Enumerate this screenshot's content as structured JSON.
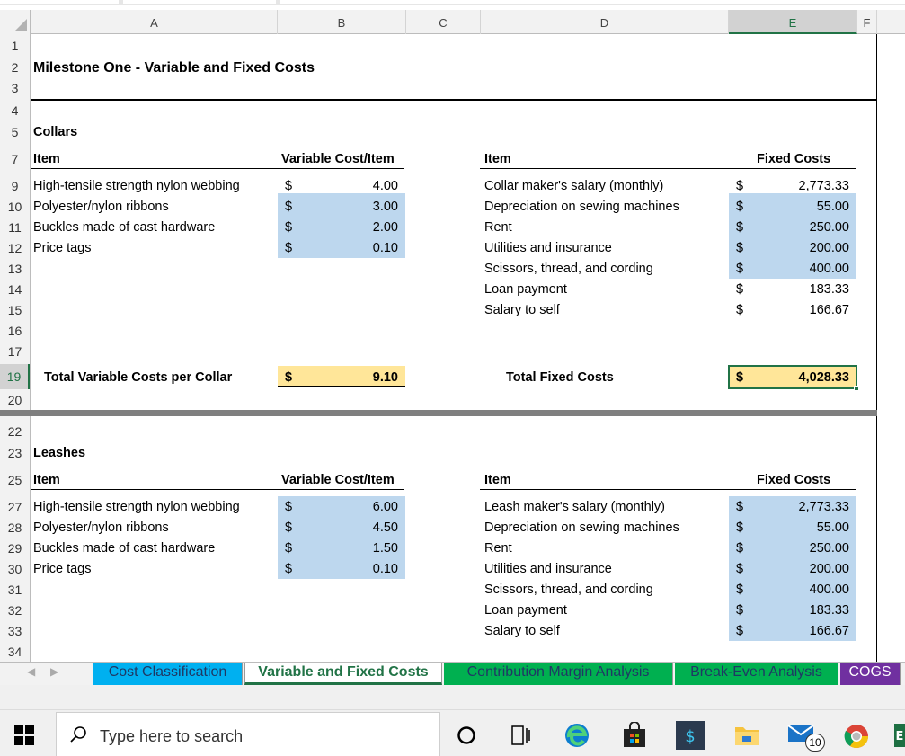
{
  "columns": [
    "A",
    "B",
    "C",
    "D",
    "E",
    "F"
  ],
  "rows": [
    "1",
    "2",
    "3",
    "4",
    "5",
    "7",
    "9",
    "10",
    "11",
    "12",
    "13",
    "14",
    "15",
    "16",
    "17",
    "19",
    "20",
    "22",
    "23",
    "25",
    "27",
    "28",
    "29",
    "30",
    "31",
    "32",
    "33",
    "34"
  ],
  "title": "Milestone One - Variable and Fixed Costs",
  "collars": {
    "heading": "Collars",
    "var_header": {
      "item": "Item",
      "cost": "Variable Cost/Item"
    },
    "fixed_header": {
      "item": "Item",
      "cost": "Fixed Costs"
    },
    "var_items": [
      {
        "name": "High-tensile strength nylon webbing",
        "cur": "$",
        "value": "4.00"
      },
      {
        "name": "Polyester/nylon ribbons",
        "cur": "$",
        "value": "3.00"
      },
      {
        "name": "Buckles made of cast hardware",
        "cur": "$",
        "value": "2.00"
      },
      {
        "name": "Price tags",
        "cur": "$",
        "value": "0.10"
      }
    ],
    "fixed_items": [
      {
        "name": "Collar maker's salary (monthly)",
        "cur": "$",
        "value": "2,773.33"
      },
      {
        "name": "Depreciation on sewing machines",
        "cur": "$",
        "value": "55.00"
      },
      {
        "name": "Rent",
        "cur": "$",
        "value": "250.00"
      },
      {
        "name": "Utilities and insurance",
        "cur": "$",
        "value": "200.00"
      },
      {
        "name": "Scissors, thread, and cording",
        "cur": "$",
        "value": "400.00"
      },
      {
        "name": "Loan payment",
        "cur": "$",
        "value": "183.33"
      },
      {
        "name": "Salary to self",
        "cur": "$",
        "value": "166.67"
      }
    ],
    "total_var_label": "Total Variable Costs per Collar",
    "total_var_cur": "$",
    "total_var_value": "9.10",
    "total_fixed_label": "Total Fixed Costs",
    "total_fixed_cur": "$",
    "total_fixed_value": "4,028.33"
  },
  "leashes": {
    "heading": "Leashes",
    "var_header": {
      "item": "Item",
      "cost": "Variable Cost/Item"
    },
    "fixed_header": {
      "item": "Item",
      "cost": "Fixed Costs"
    },
    "var_items": [
      {
        "name": "High-tensile strength nylon webbing",
        "cur": "$",
        "value": "6.00"
      },
      {
        "name": "Polyester/nylon ribbons",
        "cur": "$",
        "value": "4.50"
      },
      {
        "name": "Buckles made of cast hardware",
        "cur": "$",
        "value": "1.50"
      },
      {
        "name": "Price tags",
        "cur": "$",
        "value": "0.10"
      }
    ],
    "fixed_items": [
      {
        "name": "Leash maker's salary (monthly)",
        "cur": "$",
        "value": "2,773.33"
      },
      {
        "name": "Depreciation on sewing machines",
        "cur": "$",
        "value": "55.00"
      },
      {
        "name": "Rent",
        "cur": "$",
        "value": "250.00"
      },
      {
        "name": "Utilities and insurance",
        "cur": "$",
        "value": "200.00"
      },
      {
        "name": "Scissors, thread, and cording",
        "cur": "$",
        "value": "400.00"
      },
      {
        "name": "Loan payment",
        "cur": "$",
        "value": "183.33"
      },
      {
        "name": "Salary to self",
        "cur": "$",
        "value": "166.67"
      }
    ]
  },
  "sheet_tabs": [
    {
      "label": "Cost Classification",
      "bg": "#00b0f0",
      "active": false
    },
    {
      "label": "Variable and Fixed Costs",
      "bg": "#ffffff",
      "active": true
    },
    {
      "label": "Contribution Margin Analysis",
      "bg": "#00b050",
      "active": false
    },
    {
      "label": "Break-Even Analysis",
      "bg": "#00b050",
      "active": false
    },
    {
      "label": "COGS",
      "bg": "#7030a0",
      "active": false
    }
  ],
  "taskbar": {
    "search_placeholder": "Type here to search",
    "mail_badge": "10",
    "icons": [
      "windows-start-icon",
      "cortana-icon",
      "task-view-icon",
      "edge-icon",
      "store-icon",
      "powershell-icon",
      "file-explorer-icon",
      "mail-icon",
      "chrome-icon",
      "excel-icon"
    ]
  },
  "colors": {
    "input_fill": "#bdd7ee",
    "total_fill": "#ffe699",
    "excel_green": "#217346"
  }
}
